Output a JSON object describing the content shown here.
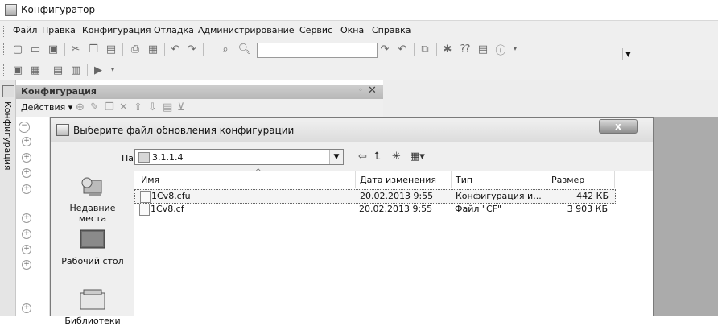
{
  "window": {
    "title": "Конфигуратор -"
  },
  "menu": [
    "Файл",
    "Правка",
    "Конфигурация",
    "Отладка",
    "Администрирование",
    "Сервис",
    "Окна",
    "Справка"
  ],
  "side_panel": {
    "tab_label": "Конфигурация"
  },
  "config_panel": {
    "title": "Конфигурация",
    "actions_label": "Действия ▾"
  },
  "dialog": {
    "title": "Выберите файл обновления конфигурации",
    "close_label": "x",
    "folder_label": "Папка:",
    "folder_value": "3.1.1.4",
    "places": [
      {
        "label": "Недавние места",
        "icon": "recent-places-icon"
      },
      {
        "label": "Рабочий стол",
        "icon": "desktop-icon"
      },
      {
        "label": "Библиотеки",
        "icon": "libraries-icon"
      }
    ],
    "columns": [
      "Имя",
      "Дата изменения",
      "Тип",
      "Размер"
    ],
    "files": [
      {
        "name": "1Cv8.cfu",
        "date": "20.02.2013 9:55",
        "type": "Конфигурация и...",
        "size": "442 КБ",
        "selected": true
      },
      {
        "name": "1Cv8.cf",
        "date": "20.02.2013 9:55",
        "type": "Файл \"CF\"",
        "size": "3 903 КБ",
        "selected": false
      }
    ]
  }
}
